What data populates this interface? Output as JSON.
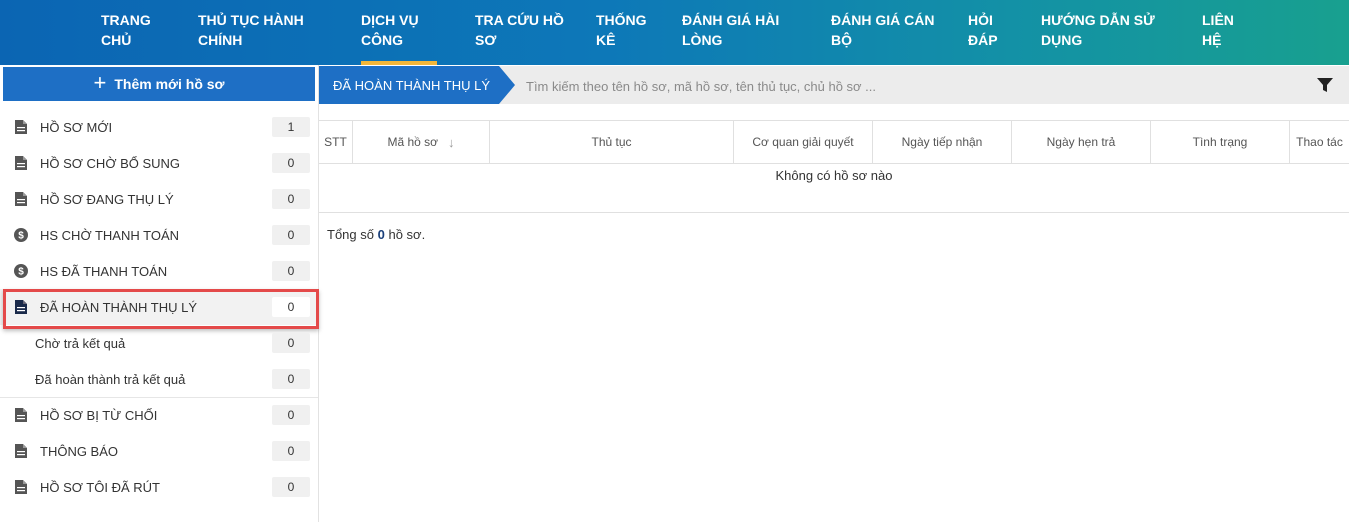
{
  "nav": {
    "items": [
      {
        "l1": "TRANG",
        "l2": "CHỦ"
      },
      {
        "l1": "THỦ TỤC HÀNH",
        "l2": "CHÍNH"
      },
      {
        "l1": "DỊCH VỤ",
        "l2": "CÔNG"
      },
      {
        "l1": "TRA CỨU HỒ",
        "l2": "SƠ"
      },
      {
        "l1": "THỐNG",
        "l2": "KÊ"
      },
      {
        "l1": "ĐÁNH GIÁ HÀI",
        "l2": "LÒNG"
      },
      {
        "l1": "ĐÁNH GIÁ CÁN",
        "l2": "BỘ"
      },
      {
        "l1": "HỎI",
        "l2": "ĐÁP"
      },
      {
        "l1": "HƯỚNG DẪN SỬ",
        "l2": "DỤNG"
      },
      {
        "l1": "LIÊN",
        "l2": "HỆ"
      }
    ],
    "active_index": 2,
    "accent_color": "#f3b63a"
  },
  "sidebar": {
    "add_button": "Thêm mới hồ sơ",
    "items": [
      {
        "label": "HỒ SƠ MỚI",
        "count": "1",
        "icon": "document-icon"
      },
      {
        "label": "HỒ SƠ CHỜ BỔ SUNG",
        "count": "0",
        "icon": "document-icon"
      },
      {
        "label": "HỒ SƠ ĐANG THỤ LÝ",
        "count": "0",
        "icon": "document-icon"
      },
      {
        "label": "HS CHỜ THANH TOÁN",
        "count": "0",
        "icon": "dollar-circle-icon"
      },
      {
        "label": "HS ĐÃ THANH TOÁN",
        "count": "0",
        "icon": "dollar-circle-icon"
      },
      {
        "label": "ĐÃ HOÀN THÀNH THỤ LÝ",
        "count": "0",
        "icon": "document-icon"
      },
      {
        "label": "Chờ trả kết quả",
        "count": "0"
      },
      {
        "label": "Đã hoàn thành trả kết quả",
        "count": "0"
      },
      {
        "label": "HỒ SƠ BỊ TỪ CHỐI",
        "count": "0",
        "icon": "document-icon"
      },
      {
        "label": "THÔNG BÁO",
        "count": "0",
        "icon": "document-icon"
      },
      {
        "label": "HỒ SƠ TÔI ĐÃ RÚT",
        "count": "0",
        "icon": "document-icon"
      }
    ]
  },
  "main": {
    "breadcrumb": "ĐÃ HOÀN THÀNH THỤ LÝ",
    "search_placeholder": "Tìm kiếm theo tên hồ sơ, mã hồ sơ, tên thủ tục, chủ hồ sơ ...",
    "columns": [
      "STT",
      "Mã hồ sơ",
      "Thủ tục",
      "Cơ quan giải quyết",
      "Ngày tiếp nhận",
      "Ngày hẹn trả",
      "Tình trạng",
      "Thao tác"
    ],
    "empty_text": "Không có hồ sơ nào",
    "total_prefix": "Tổng số",
    "total_count": "0",
    "total_suffix": "hồ sơ."
  },
  "colors": {
    "primary": "#1e6fc5",
    "highlight": "#e44a4a"
  }
}
